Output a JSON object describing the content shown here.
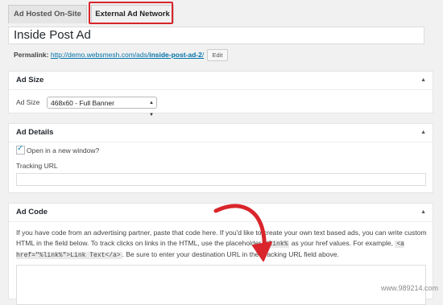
{
  "tabs": {
    "hosted": "Ad Hosted On-Site",
    "external": "External Ad Network"
  },
  "post": {
    "title": "Inside Post Ad"
  },
  "permalink": {
    "label": "Permalink:",
    "url_prefix": "http://demo.websmesh.com/ads/",
    "url_slug": "inside-post-ad-2",
    "url_suffix": "/",
    "edit": "Edit"
  },
  "ad_size": {
    "heading": "Ad Size",
    "label": "Ad Size",
    "selected": "468x60 - Full Banner"
  },
  "ad_details": {
    "heading": "Ad Details",
    "new_window_label": "Open in a new window?",
    "new_window_checked": true,
    "tracking_label": "Tracking URL",
    "tracking_value": ""
  },
  "ad_code": {
    "heading": "Ad Code",
    "desc_1": "If you have code from an advertising partner, paste that code here. If you'd like to create your own text based ads, you can write custom HTML in the field below. To track clicks on links in the HTML, use the placeholder ",
    "placeholder_code": "%link%",
    "desc_2": " as your href values. For example, ",
    "example_code": "<a href=\"%link%\">Link Text</a>",
    "desc_3": ". Be sure to enter your destination URL in the Tracking URL field above."
  },
  "watermark": "www.989214.com",
  "colors": {
    "highlight": "#d9252b",
    "link": "#0073aa",
    "checkmark": "#1e8cbe"
  }
}
